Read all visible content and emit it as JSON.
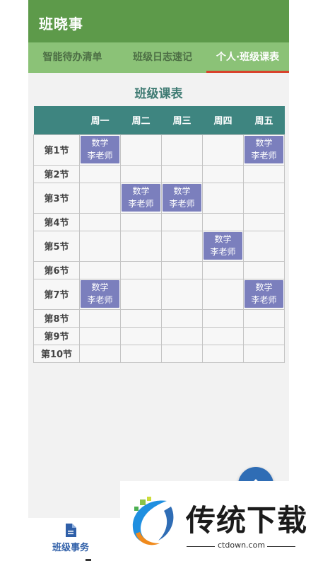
{
  "app": {
    "title": "班晓事"
  },
  "tabs": [
    {
      "label": "智能待办清单"
    },
    {
      "label": "班级日志速记"
    },
    {
      "label": "个人·班级课表"
    }
  ],
  "timetable": {
    "title": "班级课表",
    "days": [
      "周一",
      "周二",
      "周三",
      "周四",
      "周五"
    ],
    "periods": [
      {
        "label": "第1节",
        "cells": [
          "数学|李老师",
          "",
          "",
          "",
          "数学|李老师"
        ]
      },
      {
        "label": "第2节",
        "cells": [
          "",
          "",
          "",
          "",
          ""
        ]
      },
      {
        "label": "第3节",
        "cells": [
          "",
          "数学|李老师",
          "数学|李老师",
          "",
          ""
        ]
      },
      {
        "label": "第4节",
        "cells": [
          "",
          "",
          "",
          "",
          ""
        ]
      },
      {
        "label": "第5节",
        "cells": [
          "",
          "",
          "",
          "数学|李老师",
          ""
        ]
      },
      {
        "label": "第6节",
        "cells": [
          "",
          "",
          "",
          "",
          ""
        ]
      },
      {
        "label": "第7节",
        "cells": [
          "数学|李老师",
          "",
          "",
          "",
          "数学|李老师"
        ]
      },
      {
        "label": "第8节",
        "cells": [
          "",
          "",
          "",
          "",
          ""
        ]
      },
      {
        "label": "第9节",
        "cells": [
          "",
          "",
          "",
          "",
          ""
        ]
      },
      {
        "label": "第10节",
        "cells": [
          "",
          "",
          "",
          "",
          ""
        ]
      }
    ]
  },
  "bottom_nav": {
    "items": [
      {
        "label": "班级事务",
        "icon": "document-icon"
      }
    ]
  },
  "watermark": {
    "brand": "传统下载",
    "url": "ctdown.com"
  },
  "colors": {
    "appbar": "#5d9a4a",
    "tabs": "#8bc277",
    "course": "#7b7fbd",
    "header": "#3e8580",
    "indicator": "#d9432c",
    "fab": "#2f6db5"
  }
}
